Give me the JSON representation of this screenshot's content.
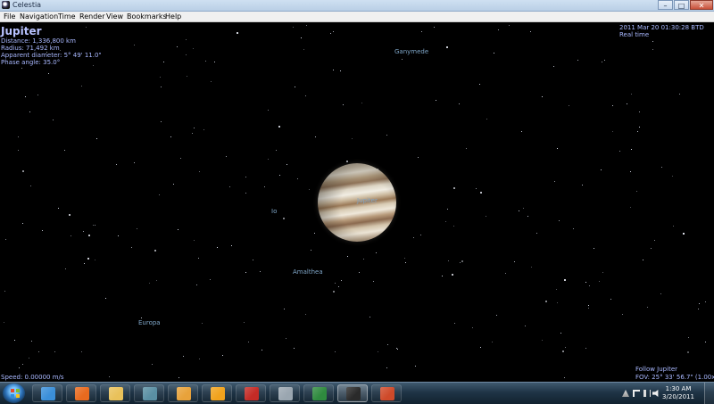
{
  "window": {
    "title": "Celestia",
    "controls": {
      "minimize": "–",
      "maximize": "□",
      "close": "✕"
    }
  },
  "menu": {
    "items": [
      "File",
      "Navigation",
      "Time",
      "Render",
      "View",
      "Bookmarks",
      "Help"
    ]
  },
  "info_panel": {
    "object_name": "Jupiter",
    "distance": "Distance: 1,336,800 km",
    "radius": "Radius: 71,492 km",
    "apparent_diameter": "Apparent diameter: 5° 49' 11.0\"",
    "phase_angle": "Phase angle: 35.0°"
  },
  "time_panel": {
    "datetime": "2011 Mar 20 01:30:28 BTD",
    "mode": "Real time"
  },
  "body_labels": {
    "jupiter": "Jupiter",
    "ganymede": "Ganymede",
    "io": "Io",
    "amalthea": "Amalthea",
    "europa": "Europa"
  },
  "status": {
    "speed": "Speed: 0.00000 m/s",
    "follow": "Follow Jupiter",
    "fov": "FOV: 25° 33' 56.7\" (1.00x)"
  },
  "taskbar": {
    "apps": [
      {
        "name": "internet-explorer-icon",
        "color": "#3b8fd9"
      },
      {
        "name": "firefox-icon",
        "color": "#e86a1f"
      },
      {
        "name": "file-explorer-icon",
        "color": "#e9c15a"
      },
      {
        "name": "app-g-icon",
        "color": "#5a8fa3"
      },
      {
        "name": "media-player-icon",
        "color": "#e8a23b"
      },
      {
        "name": "sun-app-icon",
        "color": "#f1a21d"
      },
      {
        "name": "acrobat-icon",
        "color": "#c42b26"
      },
      {
        "name": "calculator-icon",
        "color": "#9aa6b0"
      },
      {
        "name": "excel-icon",
        "color": "#2f8a3f"
      },
      {
        "name": "celestia-icon",
        "color": "#2a2a2a"
      },
      {
        "name": "powerpoint-icon",
        "color": "#cf4a2a"
      }
    ],
    "active_app": "celestia-icon",
    "clock_time": "1:30 AM",
    "clock_date": "3/20/2011"
  },
  "colors": {
    "hud_text": "#a9b8ff",
    "label_text": "#6f8fff",
    "space_bg": "#000000"
  }
}
